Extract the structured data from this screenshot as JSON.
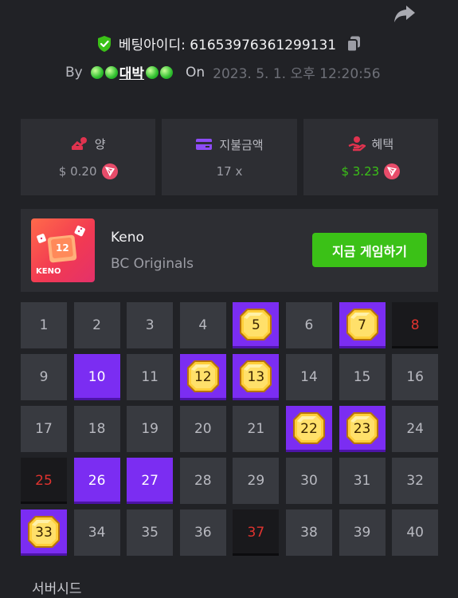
{
  "header": {
    "bet_id_label": "베팅아이디: 61653976361299131",
    "by_label": "By",
    "user_name": "대박",
    "on_label": "On",
    "date": "2023. 5. 1. 오후 12:20:56"
  },
  "stats": {
    "amount_label": "양",
    "amount_value": "$ 0.20",
    "payout_label": "지불금액",
    "payout_value": "17 x",
    "profit_label": "혜택",
    "profit_value": "$ 3.23"
  },
  "game": {
    "thumb_label": "KENO",
    "thumb_number": "12",
    "name": "Keno",
    "provider": "BC Originals",
    "play_label": "지금 게임하기"
  },
  "keno": {
    "numbers": [
      {
        "n": "1",
        "state": "none"
      },
      {
        "n": "2",
        "state": "none"
      },
      {
        "n": "3",
        "state": "none"
      },
      {
        "n": "4",
        "state": "none"
      },
      {
        "n": "5",
        "state": "hit"
      },
      {
        "n": "6",
        "state": "none"
      },
      {
        "n": "7",
        "state": "hit"
      },
      {
        "n": "8",
        "state": "miss"
      },
      {
        "n": "9",
        "state": "none"
      },
      {
        "n": "10",
        "state": "pick"
      },
      {
        "n": "11",
        "state": "none"
      },
      {
        "n": "12",
        "state": "hit"
      },
      {
        "n": "13",
        "state": "hit"
      },
      {
        "n": "14",
        "state": "none"
      },
      {
        "n": "15",
        "state": "none"
      },
      {
        "n": "16",
        "state": "none"
      },
      {
        "n": "17",
        "state": "none"
      },
      {
        "n": "18",
        "state": "none"
      },
      {
        "n": "19",
        "state": "none"
      },
      {
        "n": "20",
        "state": "none"
      },
      {
        "n": "21",
        "state": "none"
      },
      {
        "n": "22",
        "state": "hit"
      },
      {
        "n": "23",
        "state": "hit"
      },
      {
        "n": "24",
        "state": "none"
      },
      {
        "n": "25",
        "state": "miss"
      },
      {
        "n": "26",
        "state": "pick"
      },
      {
        "n": "27",
        "state": "pick"
      },
      {
        "n": "28",
        "state": "none"
      },
      {
        "n": "29",
        "state": "none"
      },
      {
        "n": "30",
        "state": "none"
      },
      {
        "n": "31",
        "state": "none"
      },
      {
        "n": "32",
        "state": "none"
      },
      {
        "n": "33",
        "state": "hit"
      },
      {
        "n": "34",
        "state": "none"
      },
      {
        "n": "35",
        "state": "none"
      },
      {
        "n": "36",
        "state": "none"
      },
      {
        "n": "37",
        "state": "miss"
      },
      {
        "n": "38",
        "state": "none"
      },
      {
        "n": "39",
        "state": "none"
      },
      {
        "n": "40",
        "state": "none"
      }
    ]
  },
  "footer": {
    "server_seed_label": "서버시드"
  },
  "colors": {
    "background": "#212226",
    "panel": "#2d2e33",
    "accent_green": "#3bc117",
    "pick_purple": "#7b2df2",
    "miss_red": "#e0332f"
  },
  "icons": [
    "share-icon",
    "shield-check-icon",
    "copy-icon",
    "coins-icon",
    "wallet-icon",
    "gift-hand-icon",
    "tron-icon"
  ]
}
